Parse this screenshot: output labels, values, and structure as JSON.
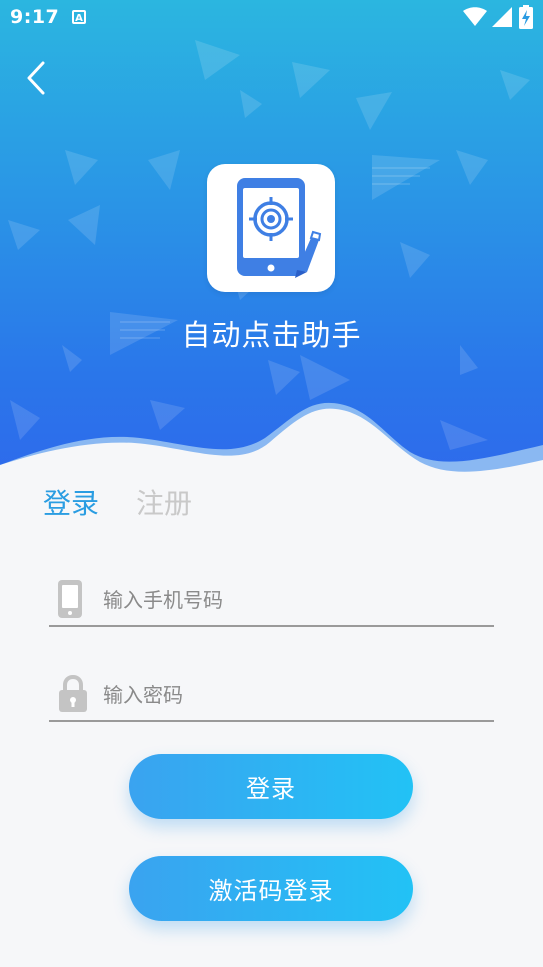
{
  "status_bar": {
    "time": "9:17",
    "notification_icon": "A",
    "icons": [
      "a-notification-icon",
      "wifi-icon",
      "signal-icon",
      "battery-charging-icon"
    ]
  },
  "header": {
    "back_icon": "chevron-left-icon",
    "app_logo_icon": "tablet-target-icon",
    "app_name": "自动点击助手"
  },
  "tabs": [
    {
      "label": "登录",
      "active": true
    },
    {
      "label": "注册",
      "active": false
    }
  ],
  "form": {
    "phone": {
      "placeholder": "输入手机号码",
      "value": "",
      "icon": "phone-icon"
    },
    "password": {
      "placeholder": "输入密码",
      "value": "",
      "icon": "lock-icon"
    }
  },
  "buttons": {
    "login_label": "登录",
    "activation_login_label": "激活码登录"
  },
  "colors": {
    "header_gradient_top": "#2bb6e0",
    "header_gradient_bottom": "#2f68ec",
    "active_tab": "#2a9de2",
    "inactive_tab": "#c9c9c9",
    "button_gradient_start": "#3aa3f0",
    "button_gradient_end": "#22c2f5",
    "background": "#f6f7f9"
  }
}
